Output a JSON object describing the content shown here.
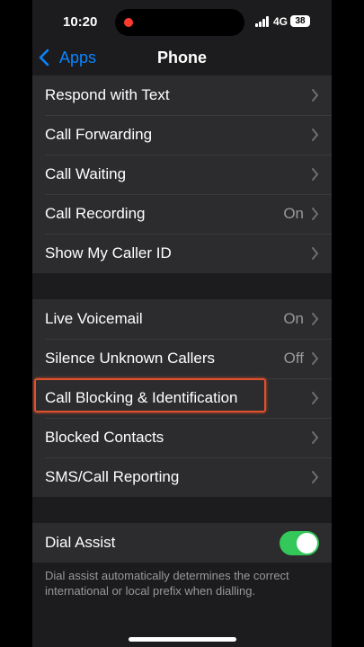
{
  "status_bar": {
    "time": "10:20",
    "network": "4G",
    "battery": "38"
  },
  "nav": {
    "back_label": "Apps",
    "title": "Phone"
  },
  "group1": [
    {
      "label": "Respond with Text",
      "value": ""
    },
    {
      "label": "Call Forwarding",
      "value": ""
    },
    {
      "label": "Call Waiting",
      "value": ""
    },
    {
      "label": "Call Recording",
      "value": "On"
    },
    {
      "label": "Show My Caller ID",
      "value": ""
    }
  ],
  "group2": [
    {
      "label": "Live Voicemail",
      "value": "On"
    },
    {
      "label": "Silence Unknown Callers",
      "value": "Off"
    },
    {
      "label": "Call Blocking & Identification",
      "value": "",
      "highlighted": true
    },
    {
      "label": "Blocked Contacts",
      "value": ""
    },
    {
      "label": "SMS/Call Reporting",
      "value": ""
    }
  ],
  "group3": {
    "dial_assist_label": "Dial Assist",
    "dial_assist_on": true,
    "footnote": "Dial assist automatically determines the correct international or local prefix when dialling."
  },
  "colors": {
    "accent": "#0a84ff",
    "toggle_on": "#34c759",
    "highlight": "#e0502c"
  }
}
